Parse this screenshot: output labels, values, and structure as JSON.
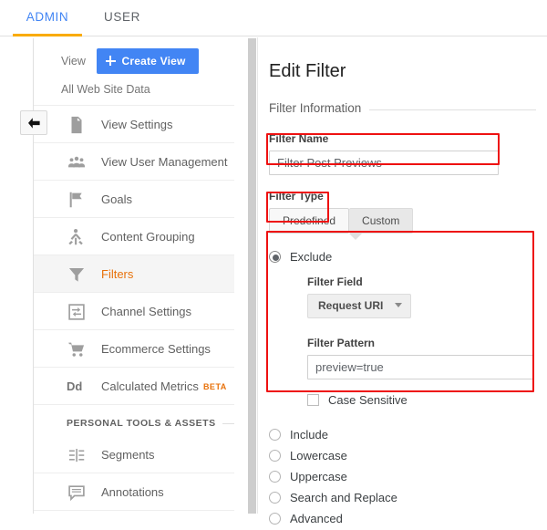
{
  "topbar": {
    "tabs": [
      {
        "label": "ADMIN",
        "active": true
      },
      {
        "label": "USER",
        "active": false
      }
    ]
  },
  "back_button": {
    "icon": "arrow-left-icon"
  },
  "sidebar": {
    "view_label": "View",
    "create_view_label": "Create View",
    "view_name": "All Web Site Data",
    "items": [
      {
        "label": "View Settings",
        "icon": "document-icon",
        "active": false
      },
      {
        "label": "View User Management",
        "icon": "people-icon",
        "active": false
      },
      {
        "label": "Goals",
        "icon": "flag-icon",
        "active": false
      },
      {
        "label": "Content Grouping",
        "icon": "person-branch-icon",
        "active": false
      },
      {
        "label": "Filters",
        "icon": "funnel-icon",
        "active": true
      },
      {
        "label": "Channel Settings",
        "icon": "channel-icon",
        "active": false
      },
      {
        "label": "Ecommerce Settings",
        "icon": "shopping-cart-icon",
        "active": false
      },
      {
        "label": "Calculated Metrics",
        "icon": "dd-text-icon",
        "badge": "BETA",
        "active": false
      }
    ],
    "section_header": "PERSONAL TOOLS & ASSETS",
    "personal_items": [
      {
        "label": "Segments",
        "icon": "segments-icon",
        "active": false
      },
      {
        "label": "Annotations",
        "icon": "comment-icon",
        "active": false
      }
    ]
  },
  "editor": {
    "title": "Edit Filter",
    "section_filter_information": "Filter Information",
    "filter_name_label": "Filter Name",
    "filter_name_value": "Filter Post Previews",
    "filter_name_placeholder": "",
    "filter_type_label": "Filter Type",
    "filter_type_options": [
      {
        "label": "Predefined",
        "selected": true
      },
      {
        "label": "Custom",
        "selected": false
      }
    ],
    "filter_verbs": [
      {
        "label": "Exclude",
        "selected": true
      },
      {
        "label": "Include",
        "selected": false
      },
      {
        "label": "Lowercase",
        "selected": false
      },
      {
        "label": "Uppercase",
        "selected": false
      },
      {
        "label": "Search and Replace",
        "selected": false
      },
      {
        "label": "Advanced",
        "selected": false
      }
    ],
    "filter_field_label": "Filter Field",
    "filter_field_value": "Request URI",
    "filter_pattern_label": "Filter Pattern",
    "filter_pattern_value": "preview=true",
    "filter_pattern_placeholder": "",
    "case_sensitive_label": "Case Sensitive",
    "case_sensitive_checked": false
  },
  "colors": {
    "accent_blue": "#4285f4",
    "accent_orange": "#f9ab00",
    "active_item": "#e8710a",
    "annotation_red": "#ee1111"
  }
}
